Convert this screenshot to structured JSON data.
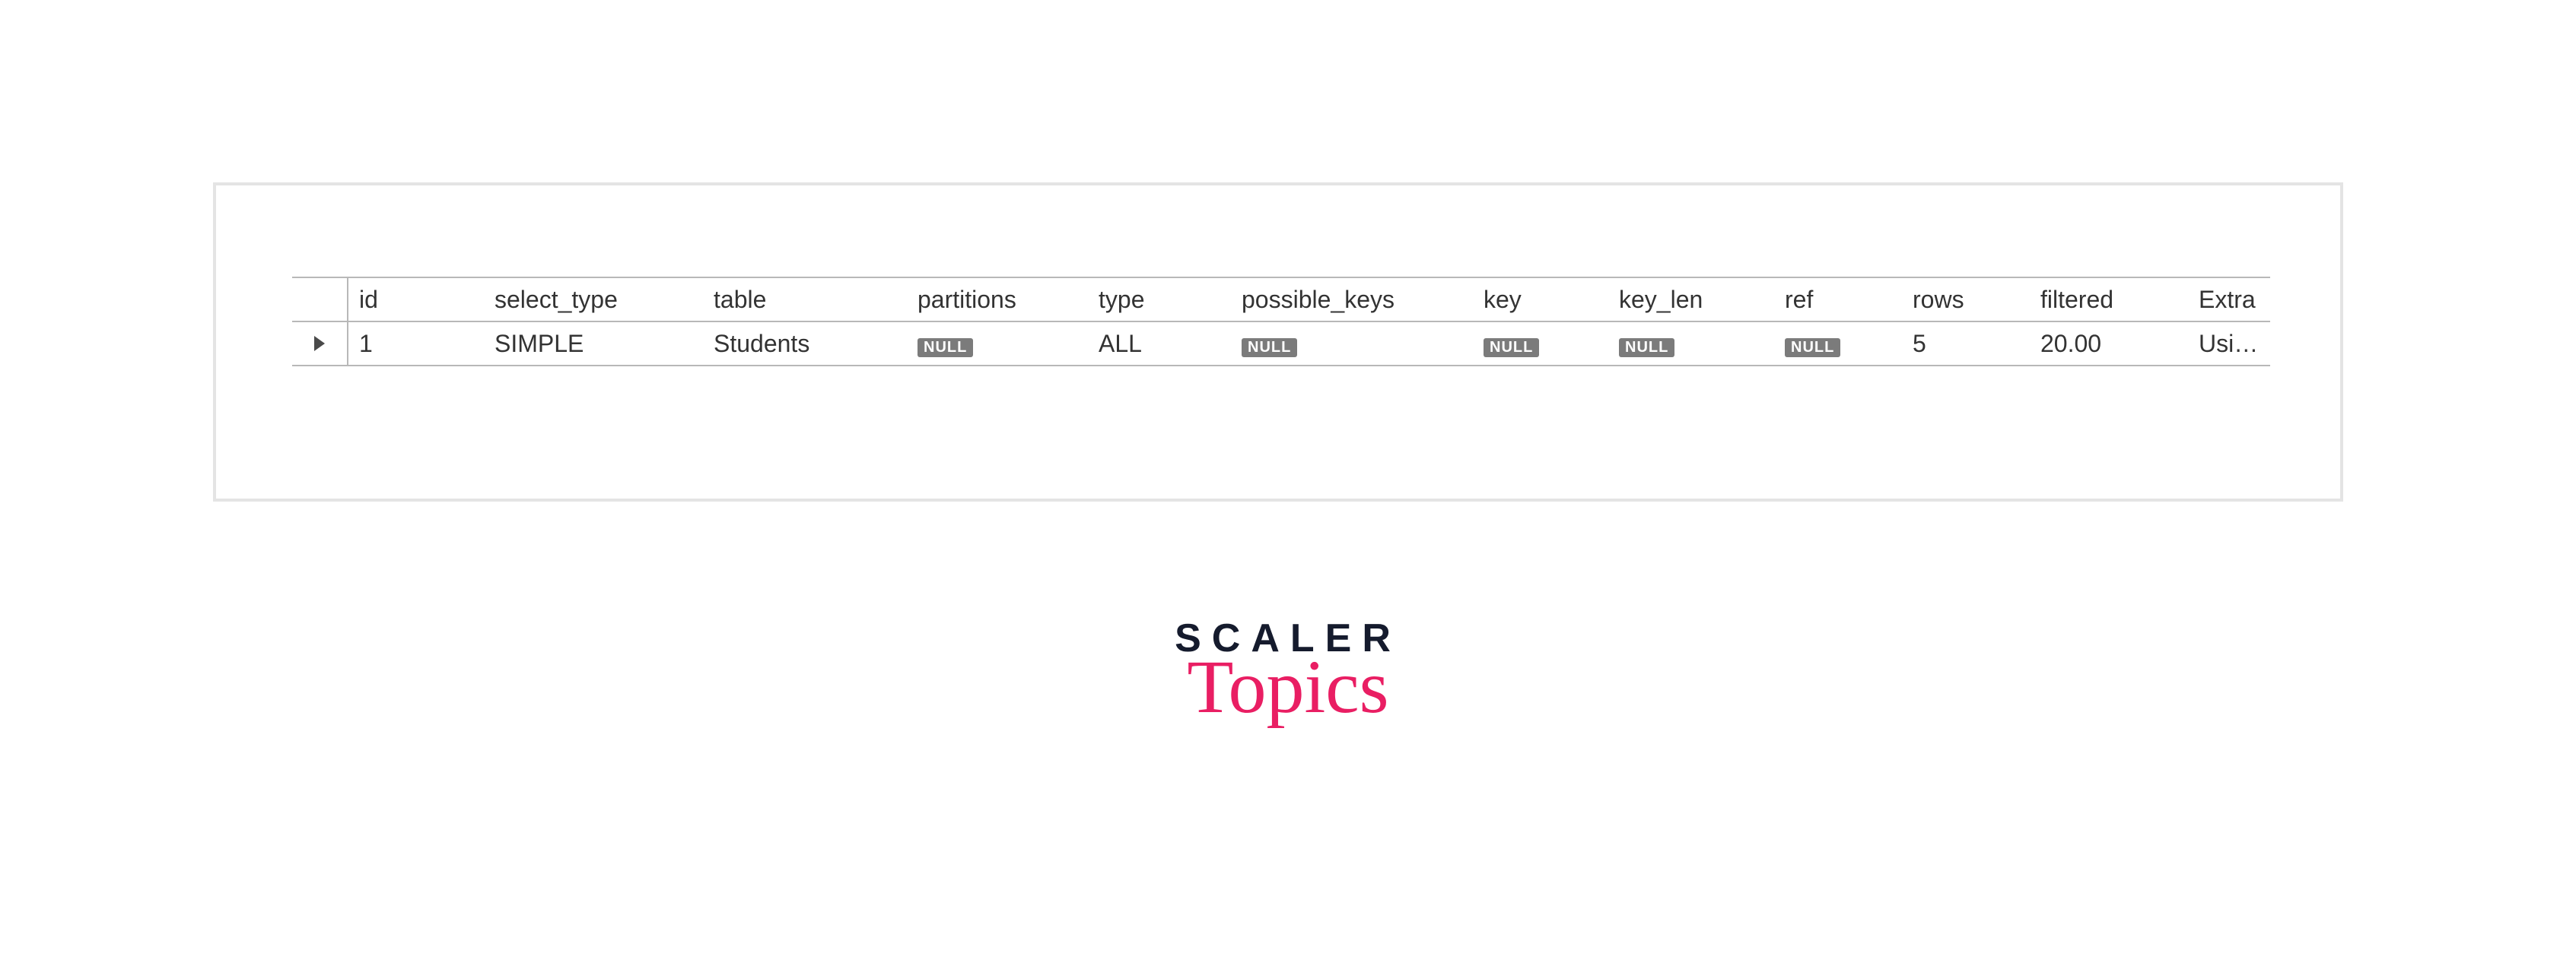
{
  "null_label": "NULL",
  "headers": {
    "id": "id",
    "select_type": "select_type",
    "table": "table",
    "partitions": "partitions",
    "type": "type",
    "possible_keys": "possible_keys",
    "key": "key",
    "key_len": "key_len",
    "ref": "ref",
    "rows": "rows",
    "filtered": "filtered",
    "extra": "Extra"
  },
  "row": {
    "id": "1",
    "select_type": "SIMPLE",
    "table": "Students",
    "partitions": null,
    "type": "ALL",
    "possible_keys": null,
    "key": null,
    "key_len": null,
    "ref": null,
    "rows": "5",
    "filtered": "20.00",
    "extra": "Using where"
  },
  "brand": {
    "line1": "SCALER",
    "line2": "Topics"
  }
}
